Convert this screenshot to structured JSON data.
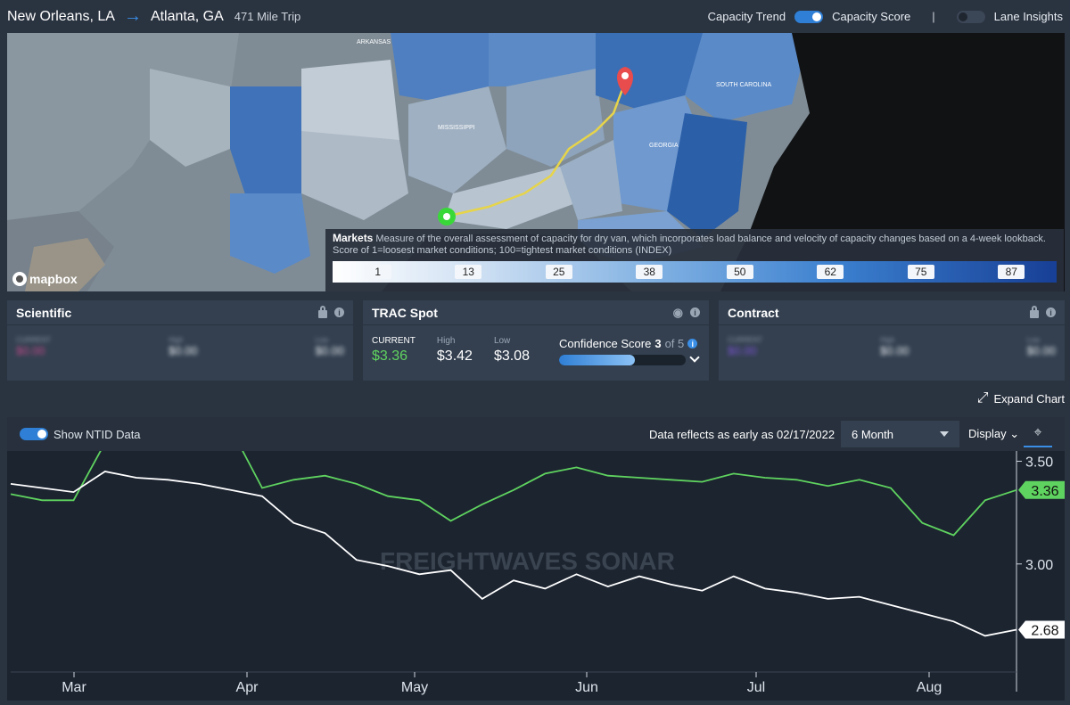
{
  "header": {
    "origin": "New Orleans, LA",
    "destination": "Atlanta, GA",
    "trip": "471 Mile Trip",
    "capacity_trend_label": "Capacity Trend",
    "capacity_score_label": "Capacity Score",
    "separator": "|",
    "lane_insights_label": "Lane Insights"
  },
  "map": {
    "state_labels": [
      "ARKANSAS",
      "MISSISSIPPI",
      "SOUTH CAROLINA",
      "GEORGIA"
    ],
    "attribution": "mapbox",
    "legend": {
      "title": "Markets",
      "description": "Measure of the overall assessment of capacity for dry van, which incorporates load balance and velocity of capacity changes based on a 4-week lookback. Score of 1=loosest market conditions; 100=tightest market conditions (INDEX)",
      "ticks": [
        "1",
        "13",
        "25",
        "38",
        "50",
        "62",
        "75",
        "87"
      ]
    }
  },
  "cards": {
    "scientific": {
      "title": "Scientific",
      "current_label": "CURRENT",
      "current": "$0.00",
      "high_label": "High",
      "high": "$0.00",
      "low_label": "Low",
      "low": "$0.00"
    },
    "trac_spot": {
      "title": "TRAC Spot",
      "current_label": "CURRENT",
      "current": "$3.36",
      "high_label": "High",
      "high": "$3.42",
      "low_label": "Low",
      "low": "$3.08",
      "confidence_label": "Confidence Score",
      "confidence_value": "3",
      "confidence_of": "of 5",
      "confidence_fraction": 0.6
    },
    "contract": {
      "title": "Contract",
      "current_label": "CURRENT",
      "current": "$0.00",
      "high_label": "High",
      "high": "$0.00",
      "low_label": "Low",
      "low": "$0.00"
    }
  },
  "chart_controls": {
    "expand_label": "Expand Chart",
    "ntid_label": "Show NTID Data",
    "reflects_label": "Data reflects as early as 02/17/2022",
    "range": "6 Month",
    "display_label": "Display",
    "watermark": "FREIGHTWAVES SONAR"
  },
  "colors": {
    "green_series": "#5fd35f",
    "white_series": "#ffffff",
    "accent": "#2f7fd6"
  },
  "chart_data": {
    "type": "line",
    "x_tick_labels": [
      "Mar",
      "Apr",
      "May",
      "Jun",
      "Jul",
      "Aug"
    ],
    "y_tick_labels": [
      "3.50",
      "3.00"
    ],
    "ylim": [
      2.5,
      3.55
    ],
    "x": [
      "02-17",
      "02-24",
      "03-01",
      "03-03",
      "03-08",
      "03-10",
      "03-12",
      "03-14",
      "03-21",
      "03-28",
      "04-04",
      "04-11",
      "04-18",
      "04-25",
      "05-02",
      "05-09",
      "05-16",
      "05-23",
      "05-30",
      "06-06",
      "06-13",
      "06-20",
      "06-27",
      "07-04",
      "07-11",
      "07-18",
      "07-25",
      "08-01",
      "08-08",
      "08-12",
      "08-15",
      "08-18",
      "08-21"
    ],
    "series": [
      {
        "values": [
          3.34,
          3.31,
          3.31,
          3.59,
          3.59,
          3.61,
          3.62,
          3.66,
          3.37,
          3.41,
          3.43,
          3.39,
          3.33,
          3.31,
          3.21,
          3.29,
          3.36,
          3.44,
          3.47,
          3.43,
          3.42,
          3.41,
          3.4,
          3.44,
          3.42,
          3.41,
          3.38,
          3.41,
          3.37,
          3.2,
          3.14,
          3.31,
          3.36
        ],
        "last_label": "3.36"
      },
      {
        "values": [
          3.39,
          3.37,
          3.35,
          3.45,
          3.42,
          3.41,
          3.39,
          3.36,
          3.33,
          3.2,
          3.15,
          3.02,
          2.99,
          2.95,
          2.97,
          2.83,
          2.92,
          2.88,
          2.95,
          2.89,
          2.94,
          2.9,
          2.87,
          2.94,
          2.88,
          2.86,
          2.83,
          2.84,
          2.8,
          2.76,
          2.72,
          2.65,
          2.68
        ],
        "last_label": "2.68"
      }
    ]
  }
}
